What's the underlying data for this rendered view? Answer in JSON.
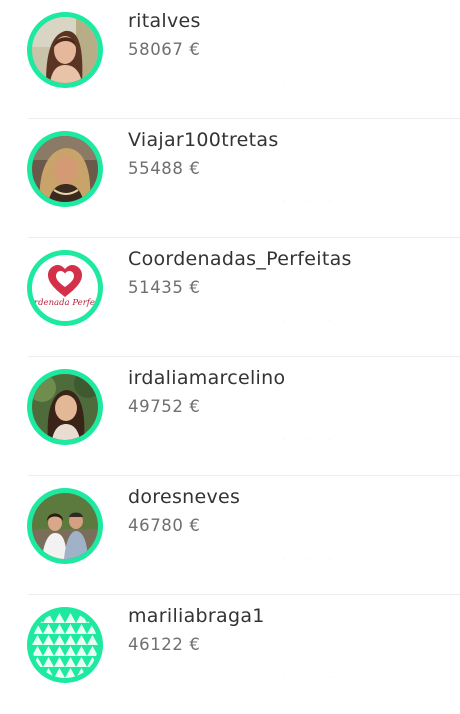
{
  "accent_color": "#1de9a0",
  "users": [
    {
      "username": "ritalves",
      "amount": "58067 €"
    },
    {
      "username": "Viajar100tretas",
      "amount": "55488 €"
    },
    {
      "username": "Coordenadas_Perfeitas",
      "amount": "51435 €",
      "avatar_logo_text": "ordenada Perfeit"
    },
    {
      "username": "irdaliamarcelino",
      "amount": "49752 €"
    },
    {
      "username": "doresneves",
      "amount": "46780 €"
    },
    {
      "username": "mariliabraga1",
      "amount": "46122 €"
    }
  ]
}
